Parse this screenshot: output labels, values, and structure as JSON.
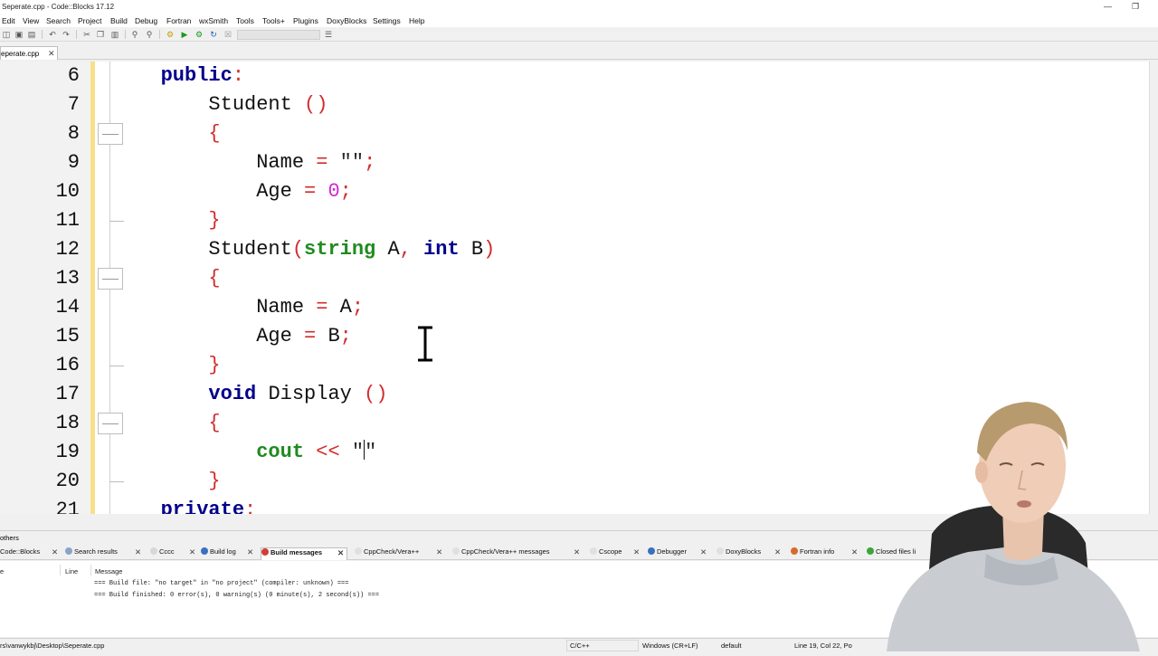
{
  "window": {
    "title": "Seperate.cpp - Code::Blocks 17.12",
    "minimize_icon": "minimize-icon",
    "restore_icon": "restore-icon"
  },
  "menu": [
    "Edit",
    "View",
    "Search",
    "Project",
    "Build",
    "Debug",
    "Fortran",
    "wxSmith",
    "Tools",
    "Tools+",
    "Plugins",
    "DoxyBlocks",
    "Settings",
    "Help"
  ],
  "file_tab": {
    "label": "eperate.cpp",
    "close": "✕"
  },
  "editor": {
    "lines": [
      {
        "n": "6"
      },
      {
        "n": "7"
      },
      {
        "n": "8"
      },
      {
        "n": "9"
      },
      {
        "n": "10"
      },
      {
        "n": "11"
      },
      {
        "n": "12"
      },
      {
        "n": "13"
      },
      {
        "n": "14"
      },
      {
        "n": "15"
      },
      {
        "n": "16"
      },
      {
        "n": "17"
      },
      {
        "n": "18"
      },
      {
        "n": "19"
      },
      {
        "n": "20"
      },
      {
        "n": "21"
      }
    ],
    "tokens": {
      "public": "public",
      "colon": ":",
      "student": "Student",
      "parens": "()",
      "brace_open": "{",
      "brace_close": "}",
      "name": "Name",
      "age": "Age",
      "eq": "=",
      "empty_str": "\"\"",
      "semi": ";",
      "zero": "0",
      "paren_open": "(",
      "paren_close": ")",
      "string": "string",
      "a": "A",
      "comma": ",",
      "int": "int",
      "b": "B",
      "void": "void",
      "display": "Display",
      "cout": "cout",
      "shift": "<<",
      "quote1": "\"",
      "quote2": "\"",
      "private": "private"
    }
  },
  "logs": {
    "header": "others",
    "tabs": [
      {
        "label": "Code::Blocks",
        "active": false
      },
      {
        "label": "Search results",
        "active": false
      },
      {
        "label": "Cccc",
        "active": false
      },
      {
        "label": "Build log",
        "active": false
      },
      {
        "label": "Build messages",
        "active": true
      },
      {
        "label": "CppCheck/Vera++",
        "active": false
      },
      {
        "label": "CppCheck/Vera++ messages",
        "active": false
      },
      {
        "label": "Cscope",
        "active": false
      },
      {
        "label": "Debugger",
        "active": false
      },
      {
        "label": "DoxyBlocks",
        "active": false
      },
      {
        "label": "Fortran info",
        "active": false
      },
      {
        "label": "Closed files li",
        "active": false
      }
    ],
    "columns": {
      "file": "e",
      "line": "Line",
      "message": "Message"
    },
    "messages": [
      "=== Build file: \"no target\" in \"no project\" (compiler: unknown) ===",
      "=== Build finished: 0 error(s), 0 warning(s) (0 minute(s), 2 second(s)) ==="
    ]
  },
  "status": {
    "path": "rs\\vanwykbj\\Desktop\\Seperate.cpp",
    "language": "C/C++",
    "eol": "Windows (CR+LF)",
    "encoding": "default",
    "position": "Line 19, Col 22, Po"
  }
}
